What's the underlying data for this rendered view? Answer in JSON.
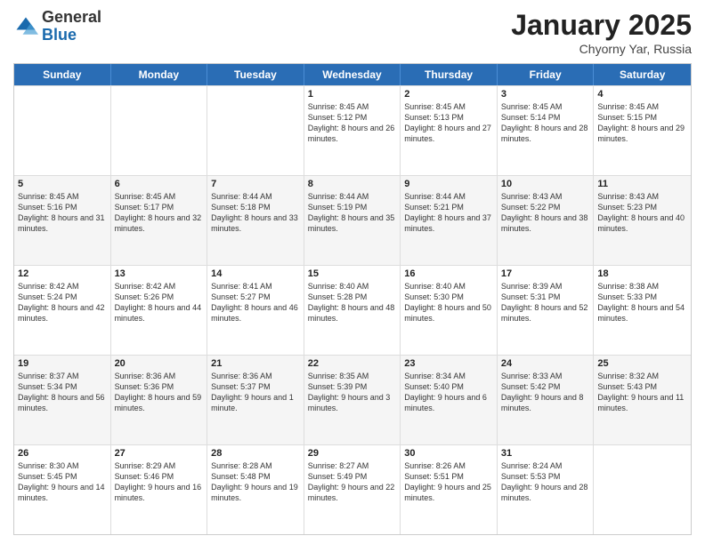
{
  "header": {
    "logo_general": "General",
    "logo_blue": "Blue",
    "month_title": "January 2025",
    "location": "Chyorny Yar, Russia"
  },
  "weekdays": [
    "Sunday",
    "Monday",
    "Tuesday",
    "Wednesday",
    "Thursday",
    "Friday",
    "Saturday"
  ],
  "rows": [
    {
      "alt": false,
      "cells": [
        {
          "day": "",
          "text": ""
        },
        {
          "day": "",
          "text": ""
        },
        {
          "day": "",
          "text": ""
        },
        {
          "day": "1",
          "text": "Sunrise: 8:45 AM\nSunset: 5:12 PM\nDaylight: 8 hours and 26 minutes."
        },
        {
          "day": "2",
          "text": "Sunrise: 8:45 AM\nSunset: 5:13 PM\nDaylight: 8 hours and 27 minutes."
        },
        {
          "day": "3",
          "text": "Sunrise: 8:45 AM\nSunset: 5:14 PM\nDaylight: 8 hours and 28 minutes."
        },
        {
          "day": "4",
          "text": "Sunrise: 8:45 AM\nSunset: 5:15 PM\nDaylight: 8 hours and 29 minutes."
        }
      ]
    },
    {
      "alt": true,
      "cells": [
        {
          "day": "5",
          "text": "Sunrise: 8:45 AM\nSunset: 5:16 PM\nDaylight: 8 hours and 31 minutes."
        },
        {
          "day": "6",
          "text": "Sunrise: 8:45 AM\nSunset: 5:17 PM\nDaylight: 8 hours and 32 minutes."
        },
        {
          "day": "7",
          "text": "Sunrise: 8:44 AM\nSunset: 5:18 PM\nDaylight: 8 hours and 33 minutes."
        },
        {
          "day": "8",
          "text": "Sunrise: 8:44 AM\nSunset: 5:19 PM\nDaylight: 8 hours and 35 minutes."
        },
        {
          "day": "9",
          "text": "Sunrise: 8:44 AM\nSunset: 5:21 PM\nDaylight: 8 hours and 37 minutes."
        },
        {
          "day": "10",
          "text": "Sunrise: 8:43 AM\nSunset: 5:22 PM\nDaylight: 8 hours and 38 minutes."
        },
        {
          "day": "11",
          "text": "Sunrise: 8:43 AM\nSunset: 5:23 PM\nDaylight: 8 hours and 40 minutes."
        }
      ]
    },
    {
      "alt": false,
      "cells": [
        {
          "day": "12",
          "text": "Sunrise: 8:42 AM\nSunset: 5:24 PM\nDaylight: 8 hours and 42 minutes."
        },
        {
          "day": "13",
          "text": "Sunrise: 8:42 AM\nSunset: 5:26 PM\nDaylight: 8 hours and 44 minutes."
        },
        {
          "day": "14",
          "text": "Sunrise: 8:41 AM\nSunset: 5:27 PM\nDaylight: 8 hours and 46 minutes."
        },
        {
          "day": "15",
          "text": "Sunrise: 8:40 AM\nSunset: 5:28 PM\nDaylight: 8 hours and 48 minutes."
        },
        {
          "day": "16",
          "text": "Sunrise: 8:40 AM\nSunset: 5:30 PM\nDaylight: 8 hours and 50 minutes."
        },
        {
          "day": "17",
          "text": "Sunrise: 8:39 AM\nSunset: 5:31 PM\nDaylight: 8 hours and 52 minutes."
        },
        {
          "day": "18",
          "text": "Sunrise: 8:38 AM\nSunset: 5:33 PM\nDaylight: 8 hours and 54 minutes."
        }
      ]
    },
    {
      "alt": true,
      "cells": [
        {
          "day": "19",
          "text": "Sunrise: 8:37 AM\nSunset: 5:34 PM\nDaylight: 8 hours and 56 minutes."
        },
        {
          "day": "20",
          "text": "Sunrise: 8:36 AM\nSunset: 5:36 PM\nDaylight: 8 hours and 59 minutes."
        },
        {
          "day": "21",
          "text": "Sunrise: 8:36 AM\nSunset: 5:37 PM\nDaylight: 9 hours and 1 minute."
        },
        {
          "day": "22",
          "text": "Sunrise: 8:35 AM\nSunset: 5:39 PM\nDaylight: 9 hours and 3 minutes."
        },
        {
          "day": "23",
          "text": "Sunrise: 8:34 AM\nSunset: 5:40 PM\nDaylight: 9 hours and 6 minutes."
        },
        {
          "day": "24",
          "text": "Sunrise: 8:33 AM\nSunset: 5:42 PM\nDaylight: 9 hours and 8 minutes."
        },
        {
          "day": "25",
          "text": "Sunrise: 8:32 AM\nSunset: 5:43 PM\nDaylight: 9 hours and 11 minutes."
        }
      ]
    },
    {
      "alt": false,
      "cells": [
        {
          "day": "26",
          "text": "Sunrise: 8:30 AM\nSunset: 5:45 PM\nDaylight: 9 hours and 14 minutes."
        },
        {
          "day": "27",
          "text": "Sunrise: 8:29 AM\nSunset: 5:46 PM\nDaylight: 9 hours and 16 minutes."
        },
        {
          "day": "28",
          "text": "Sunrise: 8:28 AM\nSunset: 5:48 PM\nDaylight: 9 hours and 19 minutes."
        },
        {
          "day": "29",
          "text": "Sunrise: 8:27 AM\nSunset: 5:49 PM\nDaylight: 9 hours and 22 minutes."
        },
        {
          "day": "30",
          "text": "Sunrise: 8:26 AM\nSunset: 5:51 PM\nDaylight: 9 hours and 25 minutes."
        },
        {
          "day": "31",
          "text": "Sunrise: 8:24 AM\nSunset: 5:53 PM\nDaylight: 9 hours and 28 minutes."
        },
        {
          "day": "",
          "text": ""
        }
      ]
    }
  ]
}
